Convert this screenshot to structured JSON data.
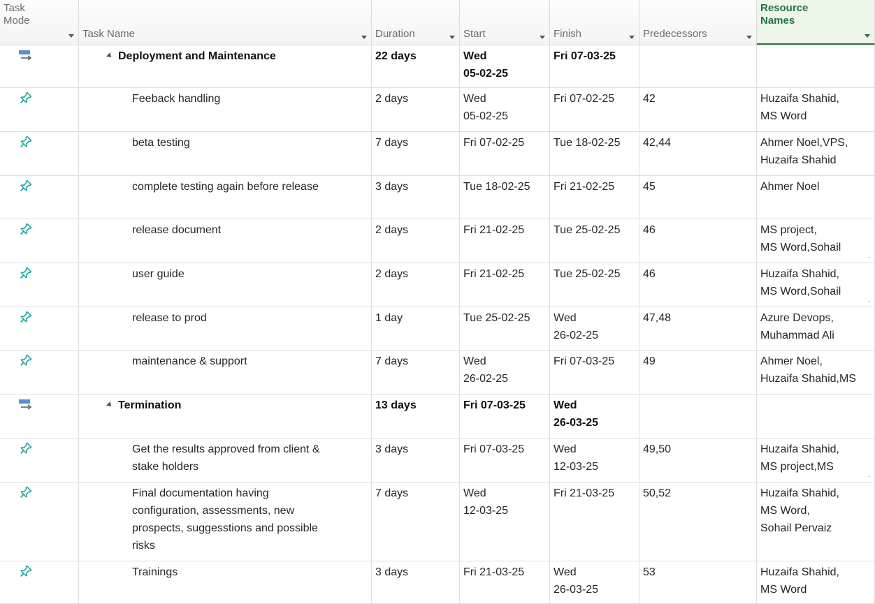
{
  "columns": {
    "task_mode": {
      "line1": "Task",
      "line2": "Mode"
    },
    "task_name": "Task Name",
    "duration": "Duration",
    "start": "Start",
    "finish": "Finish",
    "predecessors": "Predecessors",
    "resource_names": {
      "line1": "Resource",
      "line2": "Names"
    }
  },
  "rows": [
    {
      "mode": "auto",
      "summary": true,
      "name": "Deployment and Maintenance",
      "duration": "22 days",
      "start": [
        "Wed",
        "05-02-25"
      ],
      "finish": [
        "Fri 07-03-25"
      ],
      "predecessors": "",
      "resources": []
    },
    {
      "mode": "manual",
      "summary": false,
      "name": "Feeback handling",
      "duration": "2 days",
      "start": [
        "Wed",
        "05-02-25"
      ],
      "finish": [
        "Fri 07-02-25"
      ],
      "predecessors": "42",
      "resources": [
        "Huzaifa Shahid,",
        "MS Word"
      ]
    },
    {
      "mode": "manual",
      "summary": false,
      "name": "beta testing",
      "duration": "7 days",
      "start": [
        "Fri 07-02-25"
      ],
      "finish": [
        "Tue 18-02-25"
      ],
      "predecessors": "42,44",
      "resources": [
        "Ahmer Noel,VPS,",
        "Huzaifa Shahid"
      ]
    },
    {
      "mode": "manual",
      "summary": false,
      "name": "complete testing again before release",
      "duration": "3 days",
      "start": [
        "Tue 18-02-25"
      ],
      "finish": [
        "Fri 21-02-25"
      ],
      "predecessors": "45",
      "resources": [
        "Ahmer Noel"
      ]
    },
    {
      "mode": "manual",
      "summary": false,
      "name": "release document",
      "duration": "2 days",
      "start": [
        "Fri 21-02-25"
      ],
      "finish": [
        "Tue 25-02-25"
      ],
      "predecessors": "46",
      "resources": [
        "MS project,",
        "MS Word,Sohail"
      ],
      "truncated": true
    },
    {
      "mode": "manual",
      "summary": false,
      "name": "user guide",
      "duration": "2 days",
      "start": [
        "Fri 21-02-25"
      ],
      "finish": [
        "Tue 25-02-25"
      ],
      "predecessors": "46",
      "resources": [
        "Huzaifa Shahid,",
        "MS Word,Sohail"
      ],
      "truncated": true
    },
    {
      "mode": "manual",
      "summary": false,
      "name": "release to prod",
      "duration": "1 day",
      "start": [
        "Tue 25-02-25"
      ],
      "finish": [
        "Wed",
        "26-02-25"
      ],
      "predecessors": "47,48",
      "resources": [
        "Azure Devops,",
        "Muhammad Ali"
      ]
    },
    {
      "mode": "manual",
      "summary": false,
      "name": "maintenance & support",
      "duration": "7 days",
      "start": [
        "Wed",
        "26-02-25"
      ],
      "finish": [
        "Fri 07-03-25"
      ],
      "predecessors": "49",
      "resources": [
        "Ahmer Noel,",
        "Huzaifa Shahid,MS"
      ]
    },
    {
      "mode": "auto",
      "summary": true,
      "name": "Termination",
      "duration": "13 days",
      "start": [
        "Fri 07-03-25"
      ],
      "finish": [
        "Wed",
        "26-03-25"
      ],
      "predecessors": "",
      "resources": []
    },
    {
      "mode": "manual",
      "summary": false,
      "name": [
        "Get the results approved from client &",
        "stake holders"
      ],
      "duration": "3 days",
      "start": [
        "Fri 07-03-25"
      ],
      "finish": [
        "Wed",
        "12-03-25"
      ],
      "predecessors": "49,50",
      "resources": [
        "Huzaifa Shahid,",
        "MS project,MS"
      ],
      "truncated": true
    },
    {
      "mode": "manual",
      "summary": false,
      "name": [
        "Final documentation having",
        "configuration, assessments, new",
        "prospects, suggesstions and possible",
        "risks"
      ],
      "duration": "7 days",
      "start": [
        "Wed",
        "12-03-25"
      ],
      "finish": [
        "Fri 21-03-25"
      ],
      "predecessors": "50,52",
      "resources": [
        "Huzaifa Shahid,",
        "MS Word,",
        "Sohail Pervaiz"
      ]
    },
    {
      "mode": "manual",
      "summary": false,
      "name": "Trainings",
      "duration": "3 days",
      "start": [
        "Fri 21-03-25"
      ],
      "finish": [
        "Wed",
        "26-03-25"
      ],
      "predecessors": "53",
      "resources": [
        "Huzaifa Shahid,",
        "MS Word"
      ]
    }
  ],
  "colors": {
    "header_accent": "#217346",
    "manual_pin": "#1fa7a0",
    "auto_icon": "#5a8fd6"
  },
  "icons": {
    "auto": "auto-scheduled-icon",
    "manual": "manually-scheduled-pin-icon"
  }
}
